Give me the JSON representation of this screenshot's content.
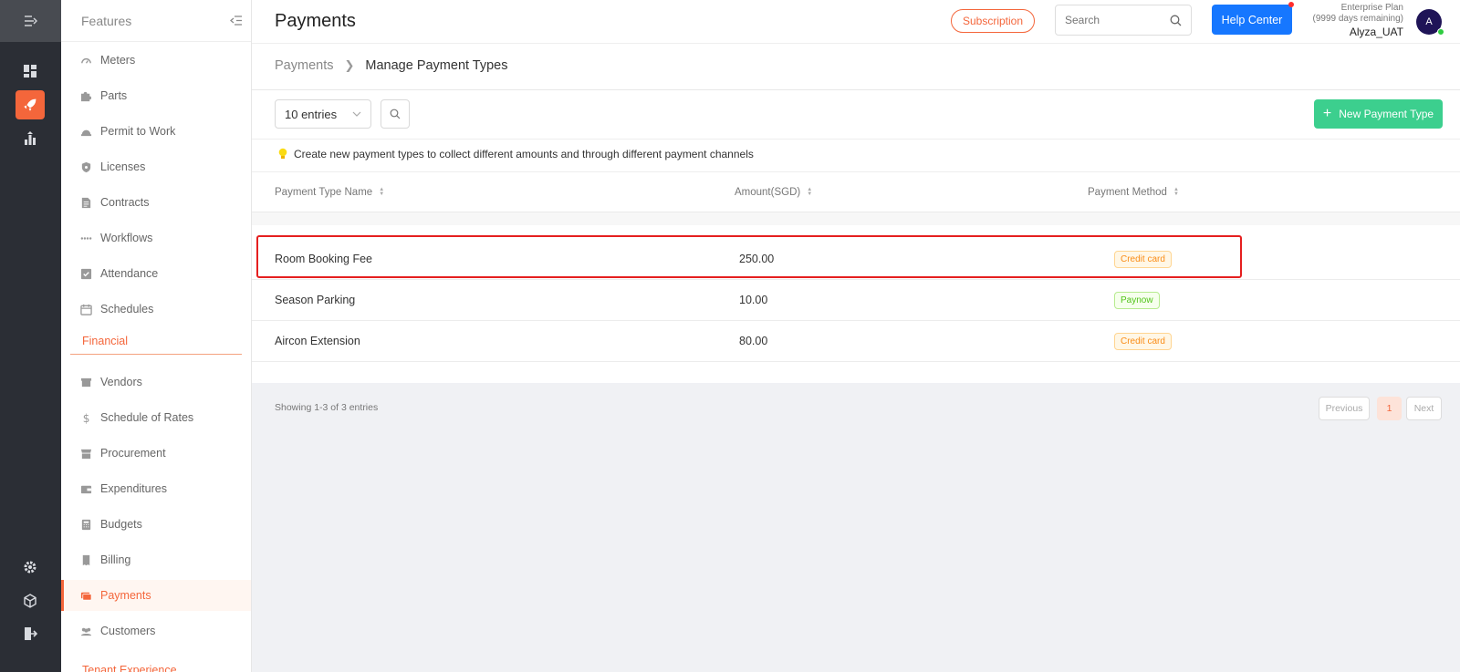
{
  "rail": {
    "items": [
      {
        "icon": "expand-menu-icon"
      },
      {
        "icon": "dashboard-icon"
      },
      {
        "icon": "rocket-icon",
        "active": true
      },
      {
        "icon": "analytics-icon"
      },
      {
        "icon": "settings-icon"
      },
      {
        "icon": "cube-icon"
      },
      {
        "icon": "logout-icon"
      }
    ]
  },
  "features": {
    "title": "Features",
    "items": [
      {
        "label": "Meters",
        "icon": "gauge-icon"
      },
      {
        "label": "Parts",
        "icon": "puzzle-icon"
      },
      {
        "label": "Permit to Work",
        "icon": "hard-hat-icon"
      },
      {
        "label": "Licenses",
        "icon": "shield-icon"
      },
      {
        "label": "Contracts",
        "icon": "document-icon"
      },
      {
        "label": "Workflows",
        "icon": "dots-icon"
      },
      {
        "label": "Attendance",
        "icon": "checkbox-icon"
      },
      {
        "label": "Schedules",
        "icon": "calendar-icon"
      }
    ],
    "section_financial": "Financial",
    "financial_items": [
      {
        "label": "Vendors",
        "icon": "store-icon"
      },
      {
        "label": "Schedule of Rates",
        "icon": "dollar-icon"
      },
      {
        "label": "Procurement",
        "icon": "shop-icon"
      },
      {
        "label": "Expenditures",
        "icon": "wallet-icon"
      },
      {
        "label": "Budgets",
        "icon": "calculator-icon"
      },
      {
        "label": "Billing",
        "icon": "receipt-icon"
      },
      {
        "label": "Payments",
        "icon": "money-icon",
        "active": true
      },
      {
        "label": "Customers",
        "icon": "users-icon"
      }
    ],
    "section_tenant": "Tenant Experience"
  },
  "header": {
    "title": "Payments",
    "subscription_label": "Subscription",
    "search_placeholder": "Search",
    "help_label": "Help Center",
    "plan": "Enterprise Plan",
    "days_remaining": "(9999 days remaining)",
    "username": "Alyza_UAT",
    "avatar_initial": "A"
  },
  "breadcrumb": {
    "root": "Payments",
    "current": "Manage Payment Types"
  },
  "toolbar": {
    "entries_label": "10 entries",
    "new_button_label": "New Payment Type"
  },
  "hint": "Create new payment types to collect different amounts and through different payment channels",
  "table": {
    "columns": [
      "Payment Type Name",
      "Amount(SGD)",
      "Payment Method"
    ],
    "rows": [
      {
        "name": "Room Booking Fee",
        "amount": "250.00",
        "method": "Credit card",
        "method_color": "orange",
        "highlighted": true
      },
      {
        "name": "Season Parking",
        "amount": "10.00",
        "method": "Paynow",
        "method_color": "green"
      },
      {
        "name": "Aircon Extension",
        "amount": "80.00",
        "method": "Credit card",
        "method_color": "orange"
      }
    ]
  },
  "footer": {
    "showing": "Showing 1-3 of 3 entries",
    "previous": "Previous",
    "current_page": "1",
    "next": "Next"
  },
  "colors": {
    "accent": "#f4663b",
    "primary": "#1677ff",
    "success": "#3ccf8e",
    "highlight": "#e51f1f"
  }
}
